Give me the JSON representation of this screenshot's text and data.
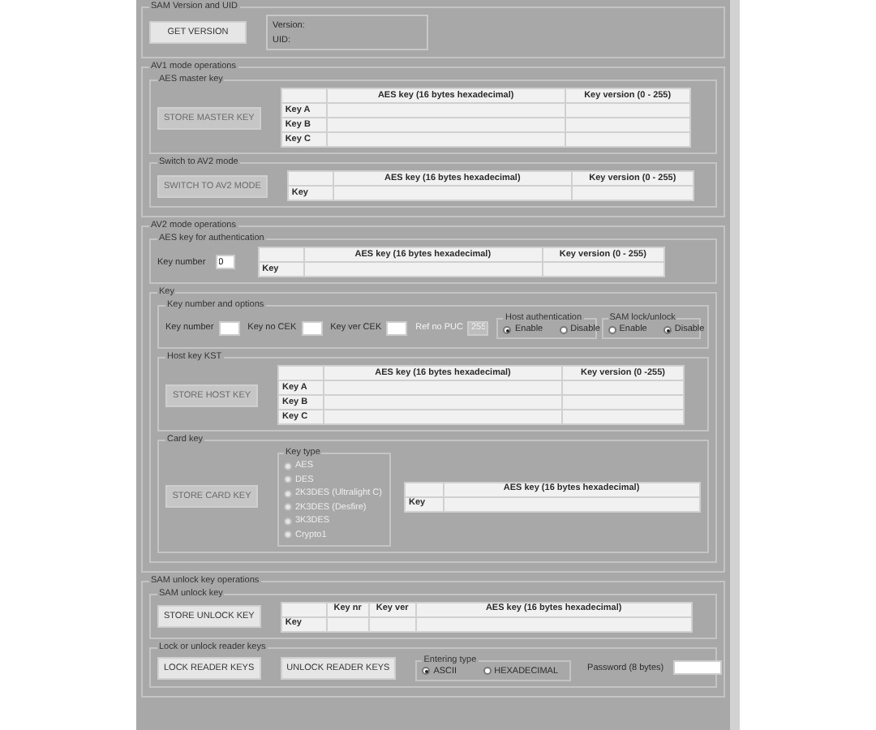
{
  "sam_version": {
    "title": "SAM Version and UID",
    "button": {
      "label": "GET VERSION",
      "disabled": false
    },
    "version_label": "Version:",
    "uid_label": "UID:"
  },
  "av1": {
    "title": "AV1 mode operations",
    "master_key": {
      "title": "AES master key",
      "button": {
        "label": "STORE MASTER KEY",
        "disabled": true
      },
      "columns": [
        "AES key (16 bytes hexadecimal)",
        "Key version (0 - 255)"
      ],
      "rows": [
        "Key A",
        "Key B",
        "Key C"
      ]
    },
    "switch_av2": {
      "title": "Switch to AV2 mode",
      "button": {
        "label": "SWITCH TO AV2 MODE",
        "disabled": true
      },
      "columns": [
        "AES key (16 bytes hexadecimal)",
        "Key version (0 - 255)"
      ],
      "rows": [
        "Key"
      ]
    }
  },
  "av2": {
    "title": "AV2 mode operations",
    "auth_key": {
      "title": "AES key for authentication",
      "key_number": {
        "label": "Key number",
        "value": "0"
      },
      "columns": [
        "AES key (16 bytes hexadecimal)",
        "Key version (0 - 255)"
      ],
      "rows": [
        "Key"
      ]
    },
    "key": {
      "title": "Key",
      "options": {
        "title": "Key number and options",
        "fields": [
          {
            "label": "Key number",
            "disabled": false
          },
          {
            "label": "Key no CEK",
            "disabled": false
          },
          {
            "label": "Key ver CEK",
            "disabled": false
          },
          {
            "label": "Ref no PUC",
            "value": "255",
            "disabled": true
          }
        ],
        "radio_groups": [
          {
            "title": "Host authentication",
            "options": [
              {
                "label": "Enable",
                "selected": true
              },
              {
                "label": "Disable",
                "selected": false
              }
            ]
          },
          {
            "title": "SAM lock/unlock",
            "options": [
              {
                "label": "Enable",
                "selected": false
              },
              {
                "label": "Disable",
                "selected": true
              }
            ]
          }
        ]
      },
      "host_key": {
        "title": "Host key KST",
        "button": {
          "label": "STORE HOST KEY",
          "disabled": true
        },
        "columns": [
          "AES key (16 bytes hexadecimal)",
          "Key version (0 -255)"
        ],
        "rows": [
          "Key A",
          "Key B",
          "Key C"
        ]
      },
      "card_key": {
        "title": "Card key",
        "button": {
          "label": "STORE CARD KEY",
          "disabled": true
        },
        "key_type": {
          "title": "Key type",
          "disabled": true,
          "options": [
            {
              "label": "AES",
              "selected": false
            },
            {
              "label": "DES",
              "selected": false
            },
            {
              "label": "2K3DES (Ultralight C)",
              "selected": false
            },
            {
              "label": "2K3DES (Desfire)",
              "selected": false
            },
            {
              "label": "3K3DES",
              "selected": false
            },
            {
              "label": "Crypto1",
              "selected": false
            }
          ]
        },
        "columns": [
          "AES key (16 bytes hexadecimal)"
        ],
        "rows": [
          "Key"
        ]
      }
    }
  },
  "sam_unlock": {
    "title": "SAM unlock key operations",
    "unlock_key": {
      "title": "SAM unlock key",
      "button": {
        "label": "STORE UNLOCK KEY",
        "disabled": false
      },
      "columns": [
        "Key nr",
        "Key ver",
        "AES key (16 bytes hexadecimal)"
      ],
      "rows": [
        "Key"
      ]
    },
    "lock": {
      "title": "Lock or unlock reader keys",
      "buttons": [
        {
          "label": "LOCK READER KEYS",
          "disabled": false
        },
        {
          "label": "UNLOCK READER KEYS",
          "disabled": false
        }
      ],
      "entering_type": {
        "title": "Entering type",
        "options": [
          {
            "label": "ASCII",
            "selected": true
          },
          {
            "label": "HEXADECIMAL",
            "selected": false
          }
        ]
      },
      "password_label": "Password (8 bytes)"
    }
  }
}
